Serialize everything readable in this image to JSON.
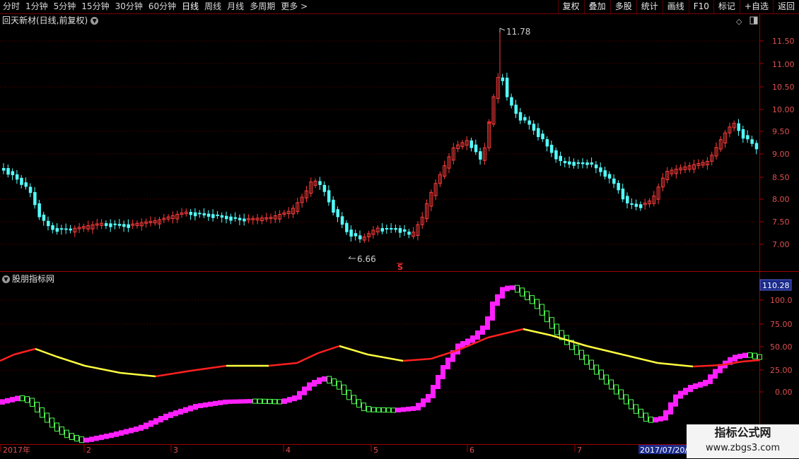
{
  "toolbar": {
    "periods": [
      "分时",
      "1分钟",
      "5分钟",
      "15分钟",
      "30分钟",
      "60分钟",
      "日线",
      "周线",
      "月线",
      "多周期",
      "更多 >"
    ],
    "active_period": "日线",
    "actions": [
      "复权",
      "叠加",
      "多股",
      "统计",
      "画线",
      "F10",
      "标记",
      "+自选",
      "返回"
    ]
  },
  "main_chart": {
    "title": "回天新材(日线,前复权)",
    "price_levels": [
      "11.50",
      "11.00",
      "10.50",
      "10.00",
      "9.50",
      "9.00",
      "8.50",
      "8.00",
      "7.50",
      "7.00"
    ],
    "high_marker": "11.78",
    "low_marker": "6.66",
    "signal_label": "S"
  },
  "indicator": {
    "title": "股朋指标网",
    "current_value": "110.28",
    "levels": [
      "100.0",
      "75.00",
      "50.00",
      "25.00",
      "0.00"
    ]
  },
  "date_axis": {
    "labels": [
      "2017年",
      "2",
      "3",
      "4",
      "5",
      "6",
      "7"
    ],
    "cursor_date": "2017/07/20/"
  },
  "colors": {
    "up_candle": "#ff3c3c",
    "down_candle": "#54ffff",
    "ma_rising": "#ff2020",
    "ma_falling": "#ffff40",
    "osc_rising": "#ff20ff",
    "osc_falling": "#50ff50"
  },
  "watermark": {
    "line1": "指标公式网",
    "line2": "www.zbgs3.com"
  }
}
